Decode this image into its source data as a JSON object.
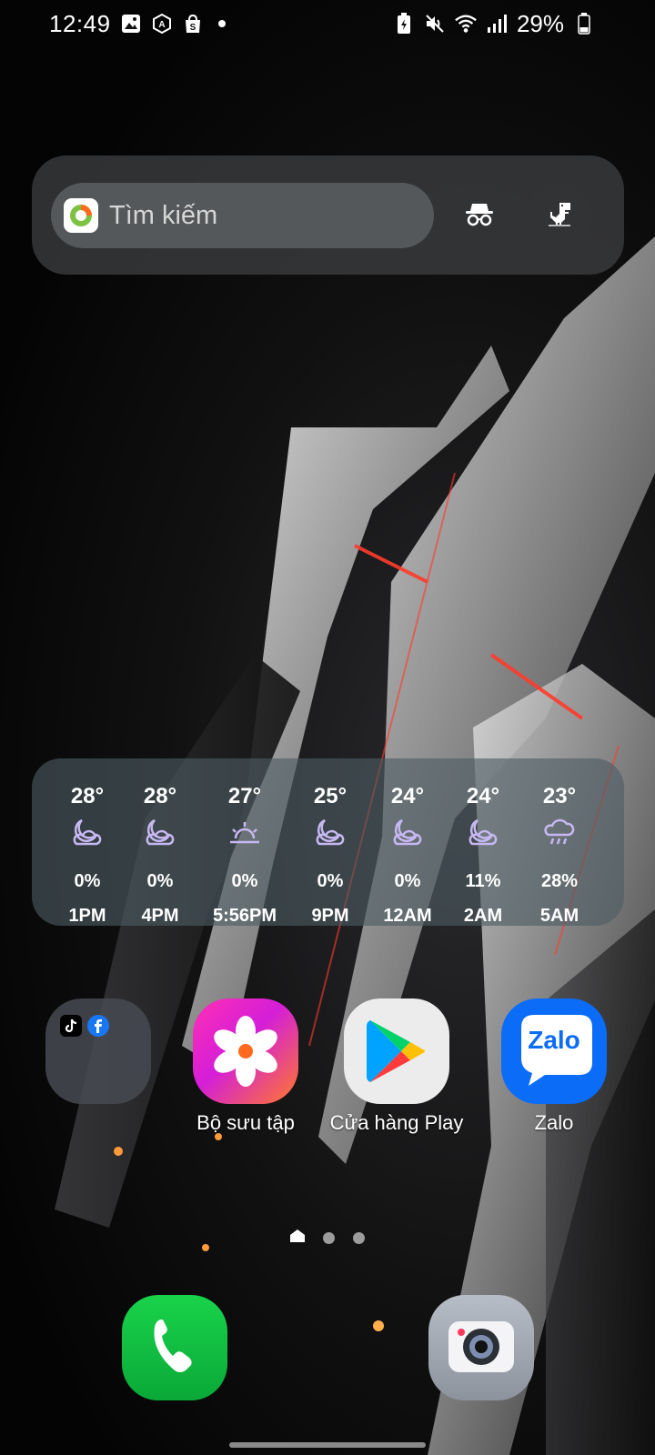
{
  "status_bar": {
    "time": "12:49",
    "left_icons": [
      "gallery-notification-icon",
      "translate-notification-icon",
      "shopee-notification-icon",
      "more-notifications-dot"
    ],
    "right_icons": [
      "battery-saver-icon",
      "mute-icon",
      "wifi-icon",
      "signal-icon",
      "battery-icon"
    ],
    "battery_percent": "29%"
  },
  "search_widget": {
    "placeholder": "Tìm kiếm",
    "logo": "coccoc-logo-icon",
    "buttons": [
      {
        "name": "incognito-button",
        "icon": "incognito-icon"
      },
      {
        "name": "dino-game-button",
        "icon": "dino-icon"
      }
    ]
  },
  "weather": {
    "hours": [
      {
        "temp": "28°",
        "icon": "moon-cloud-icon",
        "precip": "0%",
        "time": "1PM"
      },
      {
        "temp": "28°",
        "icon": "moon-cloud-icon",
        "precip": "0%",
        "time": "4PM"
      },
      {
        "temp": "27°",
        "icon": "sunset-icon",
        "precip": "0%",
        "time": "5:56PM"
      },
      {
        "temp": "25°",
        "icon": "moon-cloud-icon",
        "precip": "0%",
        "time": "9PM"
      },
      {
        "temp": "24°",
        "icon": "moon-cloud-icon",
        "precip": "0%",
        "time": "12AM"
      },
      {
        "temp": "24°",
        "icon": "moon-cloud-icon",
        "precip": "11%",
        "time": "2AM"
      },
      {
        "temp": "23°",
        "icon": "rain-cloud-icon",
        "precip": "28%",
        "time": "5AM"
      }
    ],
    "colors": {
      "icon": "#c7b8f2"
    }
  },
  "apps": [
    {
      "name": "folder",
      "label": "",
      "icons": [
        "tiktok-icon",
        "facebook-icon"
      ]
    },
    {
      "name": "gallery",
      "label": "Bộ sưu tập"
    },
    {
      "name": "play-store",
      "label": "Cửa hàng Play"
    },
    {
      "name": "zalo",
      "label": "Zalo",
      "icon_text": "Zalo"
    }
  ],
  "pager": {
    "pages": 3,
    "current": 0
  },
  "dock": [
    {
      "name": "phone",
      "icon": "phone-icon"
    },
    {
      "name": "camera",
      "icon": "camera-icon"
    }
  ]
}
